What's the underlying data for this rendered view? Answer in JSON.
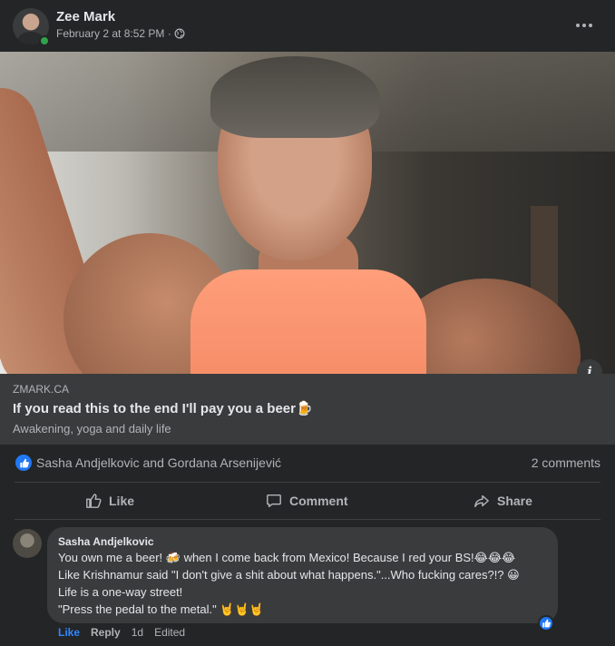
{
  "post": {
    "author": "Zee Mark",
    "timestamp": "February 2 at 8:52 PM ·",
    "privacy_icon": "globe-icon",
    "more_icon": "more-options-icon"
  },
  "link": {
    "domain": "ZMARK.CA",
    "title": "If you read this to the end I'll pay you a beer🍺",
    "subtitle": "Awakening, yoga and daily life"
  },
  "reactions": {
    "names": "Sasha Andjelkovic and Gordana Arsenijević",
    "comment_count": "2 comments"
  },
  "actions": {
    "like": "Like",
    "comment": "Comment",
    "share": "Share"
  },
  "comment": {
    "author": "Sasha Andjelkovic",
    "lines": [
      "You own me a beer! 🍻 when I come back from Mexico! Because I red your BS!😂😂😂",
      "Like Krishnamur said \"I don't give a shit about what happens.\"...Who fucking cares?!? 😀",
      "Life is a one-way street!",
      "\"Press the pedal to the metal.\" 🤘🤘🤘"
    ],
    "like": "Like",
    "reply": "Reply",
    "age": "1d",
    "edited": "Edited"
  },
  "colors": {
    "background": "#242526",
    "link_box": "#3a3b3c",
    "accent": "#2d88ff",
    "like_badge": "#2078f4",
    "online": "#31a24c"
  }
}
